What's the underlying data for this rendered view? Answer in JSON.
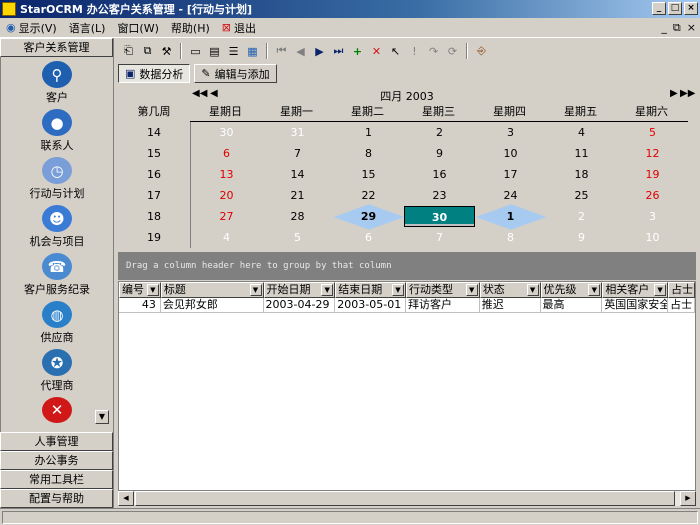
{
  "window": {
    "title": "StarOCRM 办公客户关系管理 - [行动与计划]"
  },
  "menu": [
    {
      "label": "显示(V)"
    },
    {
      "label": "语言(L)"
    },
    {
      "label": "窗口(W)"
    },
    {
      "label": "帮助(H)"
    },
    {
      "label": "退出"
    }
  ],
  "sidebar": {
    "header": "客户关系管理",
    "items": [
      {
        "label": "客户",
        "icon": "magnifier-icon",
        "color": "#1f5fb0"
      },
      {
        "label": "联系人",
        "icon": "person-icon",
        "color": "#2d6cc0"
      },
      {
        "label": "行动与计划",
        "icon": "clock-icon",
        "color": "#7a9ed8"
      },
      {
        "label": "机会与项目",
        "icon": "people-icon",
        "color": "#3a7bd5"
      },
      {
        "label": "客户服务纪录",
        "icon": "service-icon",
        "color": "#4a8ad0"
      },
      {
        "label": "供应商",
        "icon": "globe-icon",
        "color": "#2a80c8"
      },
      {
        "label": "代理商",
        "icon": "globe-star-icon",
        "color": "#2a70b0"
      }
    ],
    "close_icon_color": "#d01818",
    "footer": [
      "人事管理",
      "办公事务",
      "常用工具栏",
      "配置与帮助"
    ]
  },
  "view_tabs": [
    {
      "label": "数据分析",
      "active": true
    },
    {
      "label": "编辑与添加",
      "active": false
    }
  ],
  "calendar": {
    "month_label": "四月 2003",
    "week_header": "第几周",
    "weekdays": [
      "星期日",
      "星期一",
      "星期二",
      "星期三",
      "星期四",
      "星期五",
      "星期六"
    ],
    "weeks": [
      {
        "num": "14",
        "days": [
          [
            "30",
            "other"
          ],
          [
            "31",
            "other"
          ],
          [
            "1",
            ""
          ],
          [
            "2",
            ""
          ],
          [
            "3",
            ""
          ],
          [
            "4",
            ""
          ],
          [
            "5",
            "red"
          ]
        ]
      },
      {
        "num": "15",
        "days": [
          [
            "6",
            "red"
          ],
          [
            "7",
            ""
          ],
          [
            "8",
            ""
          ],
          [
            "9",
            ""
          ],
          [
            "10",
            ""
          ],
          [
            "11",
            ""
          ],
          [
            "12",
            "red"
          ]
        ]
      },
      {
        "num": "16",
        "days": [
          [
            "13",
            "red"
          ],
          [
            "14",
            ""
          ],
          [
            "15",
            ""
          ],
          [
            "16",
            ""
          ],
          [
            "17",
            ""
          ],
          [
            "18",
            ""
          ],
          [
            "19",
            "red"
          ]
        ]
      },
      {
        "num": "17",
        "days": [
          [
            "20",
            "red"
          ],
          [
            "21",
            ""
          ],
          [
            "22",
            ""
          ],
          [
            "23",
            ""
          ],
          [
            "24",
            ""
          ],
          [
            "25",
            ""
          ],
          [
            "26",
            "red"
          ]
        ]
      },
      {
        "num": "18",
        "days": [
          [
            "27",
            "red"
          ],
          [
            "28",
            ""
          ],
          [
            "29",
            "diamond"
          ],
          [
            "30",
            "today"
          ],
          [
            "1",
            "diamond"
          ],
          [
            "2",
            "other"
          ],
          [
            "3",
            "other"
          ]
        ]
      },
      {
        "num": "19",
        "days": [
          [
            "4",
            "other"
          ],
          [
            "5",
            "other"
          ],
          [
            "6",
            "other"
          ],
          [
            "7",
            "other"
          ],
          [
            "8",
            "other"
          ],
          [
            "9",
            "other"
          ],
          [
            "10",
            "other"
          ]
        ]
      }
    ],
    "highlight_color": "#a6caf0",
    "today_color": "#008080"
  },
  "grid": {
    "group_hint": "Drag a column header here to group by that column",
    "columns": [
      {
        "label": "编号",
        "w": 42
      },
      {
        "label": "标题",
        "w": 103
      },
      {
        "label": "开始日期",
        "w": 72
      },
      {
        "label": "结束日期",
        "w": 71
      },
      {
        "label": "行动类型",
        "w": 74
      },
      {
        "label": "状态",
        "w": 61
      },
      {
        "label": "优先级",
        "w": 62
      },
      {
        "label": "相关客户",
        "w": 66
      },
      {
        "label": "占士",
        "w": 27
      }
    ],
    "rows": [
      [
        "43",
        "会见邦女郎",
        "2003-04-29",
        "2003-05-01",
        "拜访客户",
        "推迟",
        "最高",
        "英国国家安全",
        "占士"
      ]
    ]
  }
}
